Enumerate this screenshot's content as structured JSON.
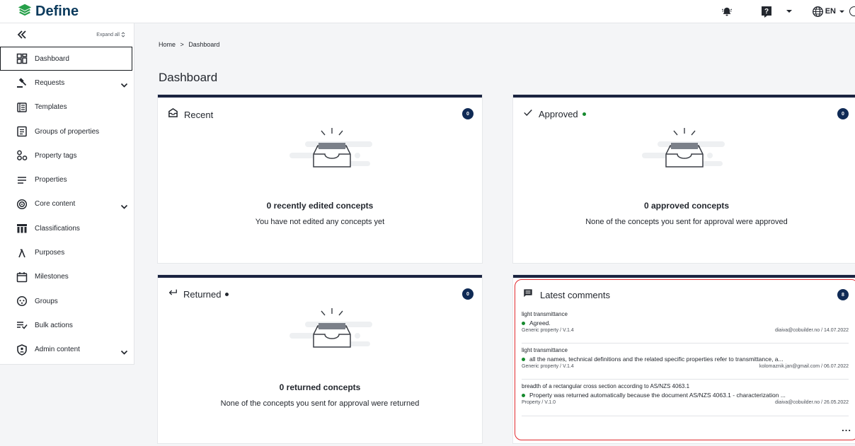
{
  "app": {
    "name": "Define"
  },
  "topbar": {
    "language": "EN"
  },
  "sidebar": {
    "expand_all": "Expand all",
    "items": [
      {
        "label": "Dashboard",
        "icon": "dashboard-icon",
        "active": true
      },
      {
        "label": "Requests",
        "icon": "gavel-icon",
        "expandable": true
      },
      {
        "label": "Templates",
        "icon": "templates-icon"
      },
      {
        "label": "Groups of properties",
        "icon": "document-list-icon"
      },
      {
        "label": "Property tags",
        "icon": "tags-icon"
      },
      {
        "label": "Properties",
        "icon": "lines-icon"
      },
      {
        "label": "Core content",
        "icon": "target-icon",
        "expandable": true
      },
      {
        "label": "Classifications",
        "icon": "classifications-icon"
      },
      {
        "label": "Purposes",
        "icon": "lambda-icon"
      },
      {
        "label": "Milestones",
        "icon": "calendar-icon"
      },
      {
        "label": "Groups",
        "icon": "groups-icon"
      },
      {
        "label": "Bulk actions",
        "icon": "bulk-actions-icon"
      },
      {
        "label": "Admin content",
        "icon": "shield-icon",
        "expandable": true
      }
    ]
  },
  "breadcrumb": {
    "home": "Home",
    "separator": ">",
    "current": "Dashboard"
  },
  "page": {
    "title": "Dashboard"
  },
  "cards": {
    "recent": {
      "title": "Recent",
      "count": "0",
      "empty_title": "0 recently edited concepts",
      "empty_sub": "You have not edited any concepts yet"
    },
    "approved": {
      "title": "Approved",
      "count": "0",
      "status_color": "#168a2e",
      "empty_title": "0 approved concepts",
      "empty_sub": "None of the concepts you sent for approval were approved"
    },
    "returned": {
      "title": "Returned",
      "count": "0",
      "status_color": "#23272e",
      "empty_title": "0 returned concepts",
      "empty_sub": "None of the concepts you sent for approval were returned"
    },
    "comments": {
      "title": "Latest comments",
      "count": "8",
      "more": "...",
      "items": [
        {
          "title": "light transmittance",
          "text": "Agreed.",
          "type": "Generic property / V.1.4",
          "author_date": "diaiva@cobuilder.no / 14.07.2022"
        },
        {
          "title": "light transmittance",
          "text": "all the names, technical definitions and the related specific properties refer to transmittance, a...",
          "type": "Generic property / V.1.4",
          "author_date": "kolomaznik.jan@gmail.com / 06.07.2022"
        },
        {
          "title": "breadth of a rectangular cross section according to AS/NZS 4063.1",
          "text": "Property was returned automatically because the document AS/NZS 4063.1 - characterization ...",
          "type": "Property / V.1.0",
          "author_date": "diaiva@cobuilder.no / 26.05.2022"
        }
      ]
    }
  },
  "colors": {
    "brand": "#0b3a5c",
    "logo_green": "#27a04a",
    "card_top": "#1a2340",
    "badge": "#0f2a55",
    "highlight": "#e0282e"
  }
}
